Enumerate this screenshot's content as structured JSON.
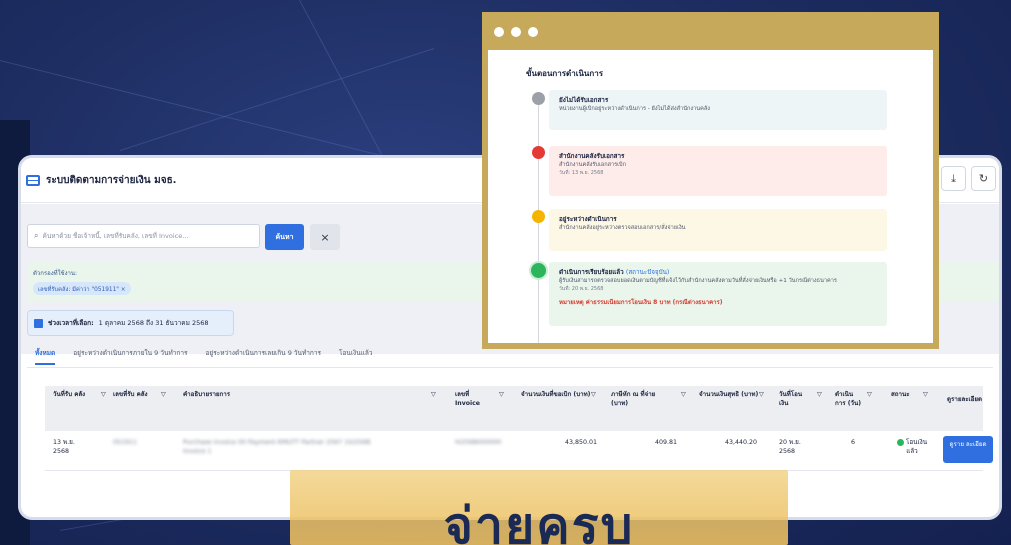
{
  "app": {
    "title": "ระบบติดตามการจ่ายเงิน มจธ.",
    "toolbar_icons": [
      "download-icon",
      "refresh-icon"
    ],
    "toolbar_glyphs": {
      "download": "⤓",
      "refresh": "↻"
    }
  },
  "search": {
    "placeholder": "ค้นหาด้วย ชื่อเจ้าหนี้, เลขที่รับคลัง, เลขที่ Invoice...",
    "search_label": "ค้นหา",
    "clear_label": "×"
  },
  "filter": {
    "label": "ตัวกรองที่ใช้งาน:",
    "chip": "เลขที่รับคลัง: มีค่าว่า \"051911\" ×"
  },
  "date_range": {
    "label": "ช่วงเวลาที่เลือก:",
    "value": "1 ตุลาคม 2568 ถึง 31 ธันวาคม 2568"
  },
  "tabs": [
    {
      "label": "ทั้งหมด",
      "active": true
    },
    {
      "label": "อยู่ระหว่างดำเนินการภายใน 9 วันทำการ",
      "active": false
    },
    {
      "label": "อยู่ระหว่างดำเนินการเลยเกิน 9 วันทำการ",
      "active": false
    },
    {
      "label": "โอนเงินแล้ว",
      "active": false
    }
  ],
  "table": {
    "headers": [
      "วันที่รับ คลัง",
      "เลขที่รับ คลัง",
      "คำอธิบายรายการ",
      "เลขที่ Invoice",
      "จำนวนเงินที่ขอเบิก (บาท)",
      "ภาษีหัก ณ ที่จ่าย (บาท)",
      "จำนวนเงินสุทธิ (บาท)",
      "วันที่โอน เงิน",
      "ดำเนิน การ (วัน)",
      "สถานะ",
      "ดูรายละเอียด"
    ],
    "rows": [
      {
        "date_received": "13 พ.ย. 2568",
        "receipt_no": "051911",
        "description": "Purchase invoice 00 Payment KMUTT Partner 2567 10/2568 Invoice 1",
        "invoice_no": "IV2568000000",
        "requested": "43,850.01",
        "withholding": "409.81",
        "net": "43,440.20",
        "transfer_date": "20 พ.ย. 2568",
        "days": "6",
        "status": "โอนเงิน แล้ว",
        "detail_label": "ดูราย ละเอียด"
      }
    ]
  },
  "overlay": {
    "title": "ขั้นตอนการดำเนินการ",
    "steps": [
      {
        "title": "ยังไม่ได้รับเอกสาร",
        "desc": "หน่วยงานผู้เบิกอยู่ระหว่างดำเนินการ - ยังไม่ได้ส่งสำนักงานคลัง",
        "date": "",
        "color": "#9ca0a8",
        "bg": "#eef5f6"
      },
      {
        "title": "สำนักงานคลังรับเอกสาร",
        "desc": "สำนักงานคลังรับเอกสารเบิก",
        "date": "วันที่: 13 พ.ย. 2568",
        "color": "#e53935",
        "bg": "#fdecea"
      },
      {
        "title": "อยู่ระหว่างดำเนินการ",
        "desc": "สำนักงานคลังอยู่ระหว่างตรวจสอบเอกสาร/สั่งจ่ายเงิน",
        "date": "",
        "color": "#f4b400",
        "bg": "#fdf8e6"
      },
      {
        "title": "ดำเนินการเรียบร้อยแล้ว",
        "current": "(สถานะปัจจุบัน)",
        "desc": "ผู้รับเงินสามารถตรวจสอบยอดเงินตามบัญชีที่แจ้งไว้กับสำนักงานคลังตามวันที่สั่งจ่ายเงินหรือ +1 วันกรณีต่างธนาคาร",
        "date": "วันที่: 20 พ.ย. 2568",
        "note": "หมายเหตุ ค่าธรรมเนียมการโอนเงิน 8 บาท (กรณีต่างธนาคาร)",
        "color": "#2db55d",
        "bg": "#eaf6ec"
      }
    ]
  },
  "promo": {
    "text": "จ่ายครบ"
  },
  "colors": {
    "accent": "#2f6fe0",
    "gold": "#c7a95c",
    "navy": "#1a2a55",
    "success": "#2db55d"
  }
}
